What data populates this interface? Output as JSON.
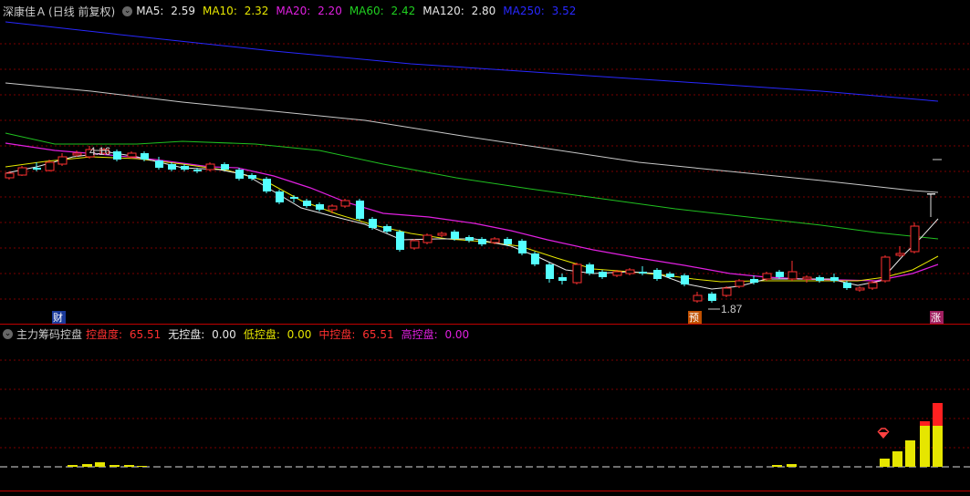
{
  "stock": {
    "name": "深康佳Ａ",
    "period": "(日线 前复权)"
  },
  "ma": [
    {
      "label": "MA5: ",
      "value": "2.59",
      "color": "#e8e8e8"
    },
    {
      "label": "MA10: ",
      "value": "2.32",
      "color": "#e6e600"
    },
    {
      "label": "MA20: ",
      "value": "2.20",
      "color": "#e020e0"
    },
    {
      "label": "MA60: ",
      "value": "2.42",
      "color": "#20d020"
    },
    {
      "label": "MA120: ",
      "value": "2.80",
      "color": "#e8e8e8"
    },
    {
      "label": "MA250: ",
      "value": "3.52",
      "color": "#2828ff"
    }
  ],
  "indicator": {
    "name": "主力筹码控盘",
    "items": [
      {
        "label": "控盘度: ",
        "value": "65.51",
        "color": "#ff3030"
      },
      {
        "label": "无控盘: ",
        "value": "0.00",
        "color": "#e8e8e8"
      },
      {
        "label": "低控盘: ",
        "value": "0.00",
        "color": "#e6e600"
      },
      {
        "label": "中控盘: ",
        "value": "65.51",
        "color": "#ff3030"
      },
      {
        "label": "高控盘: ",
        "value": "0.00",
        "color": "#e020e0"
      }
    ]
  },
  "annotations": {
    "high_label": "4.16",
    "low_label": "1.87",
    "badge_cai": "财",
    "badge_yu": "预",
    "badge_zhang": "涨"
  },
  "colors": {
    "up": "#ff3030",
    "down": "#54ffff",
    "grid": "#7a0000",
    "axis": "#c00000"
  }
}
